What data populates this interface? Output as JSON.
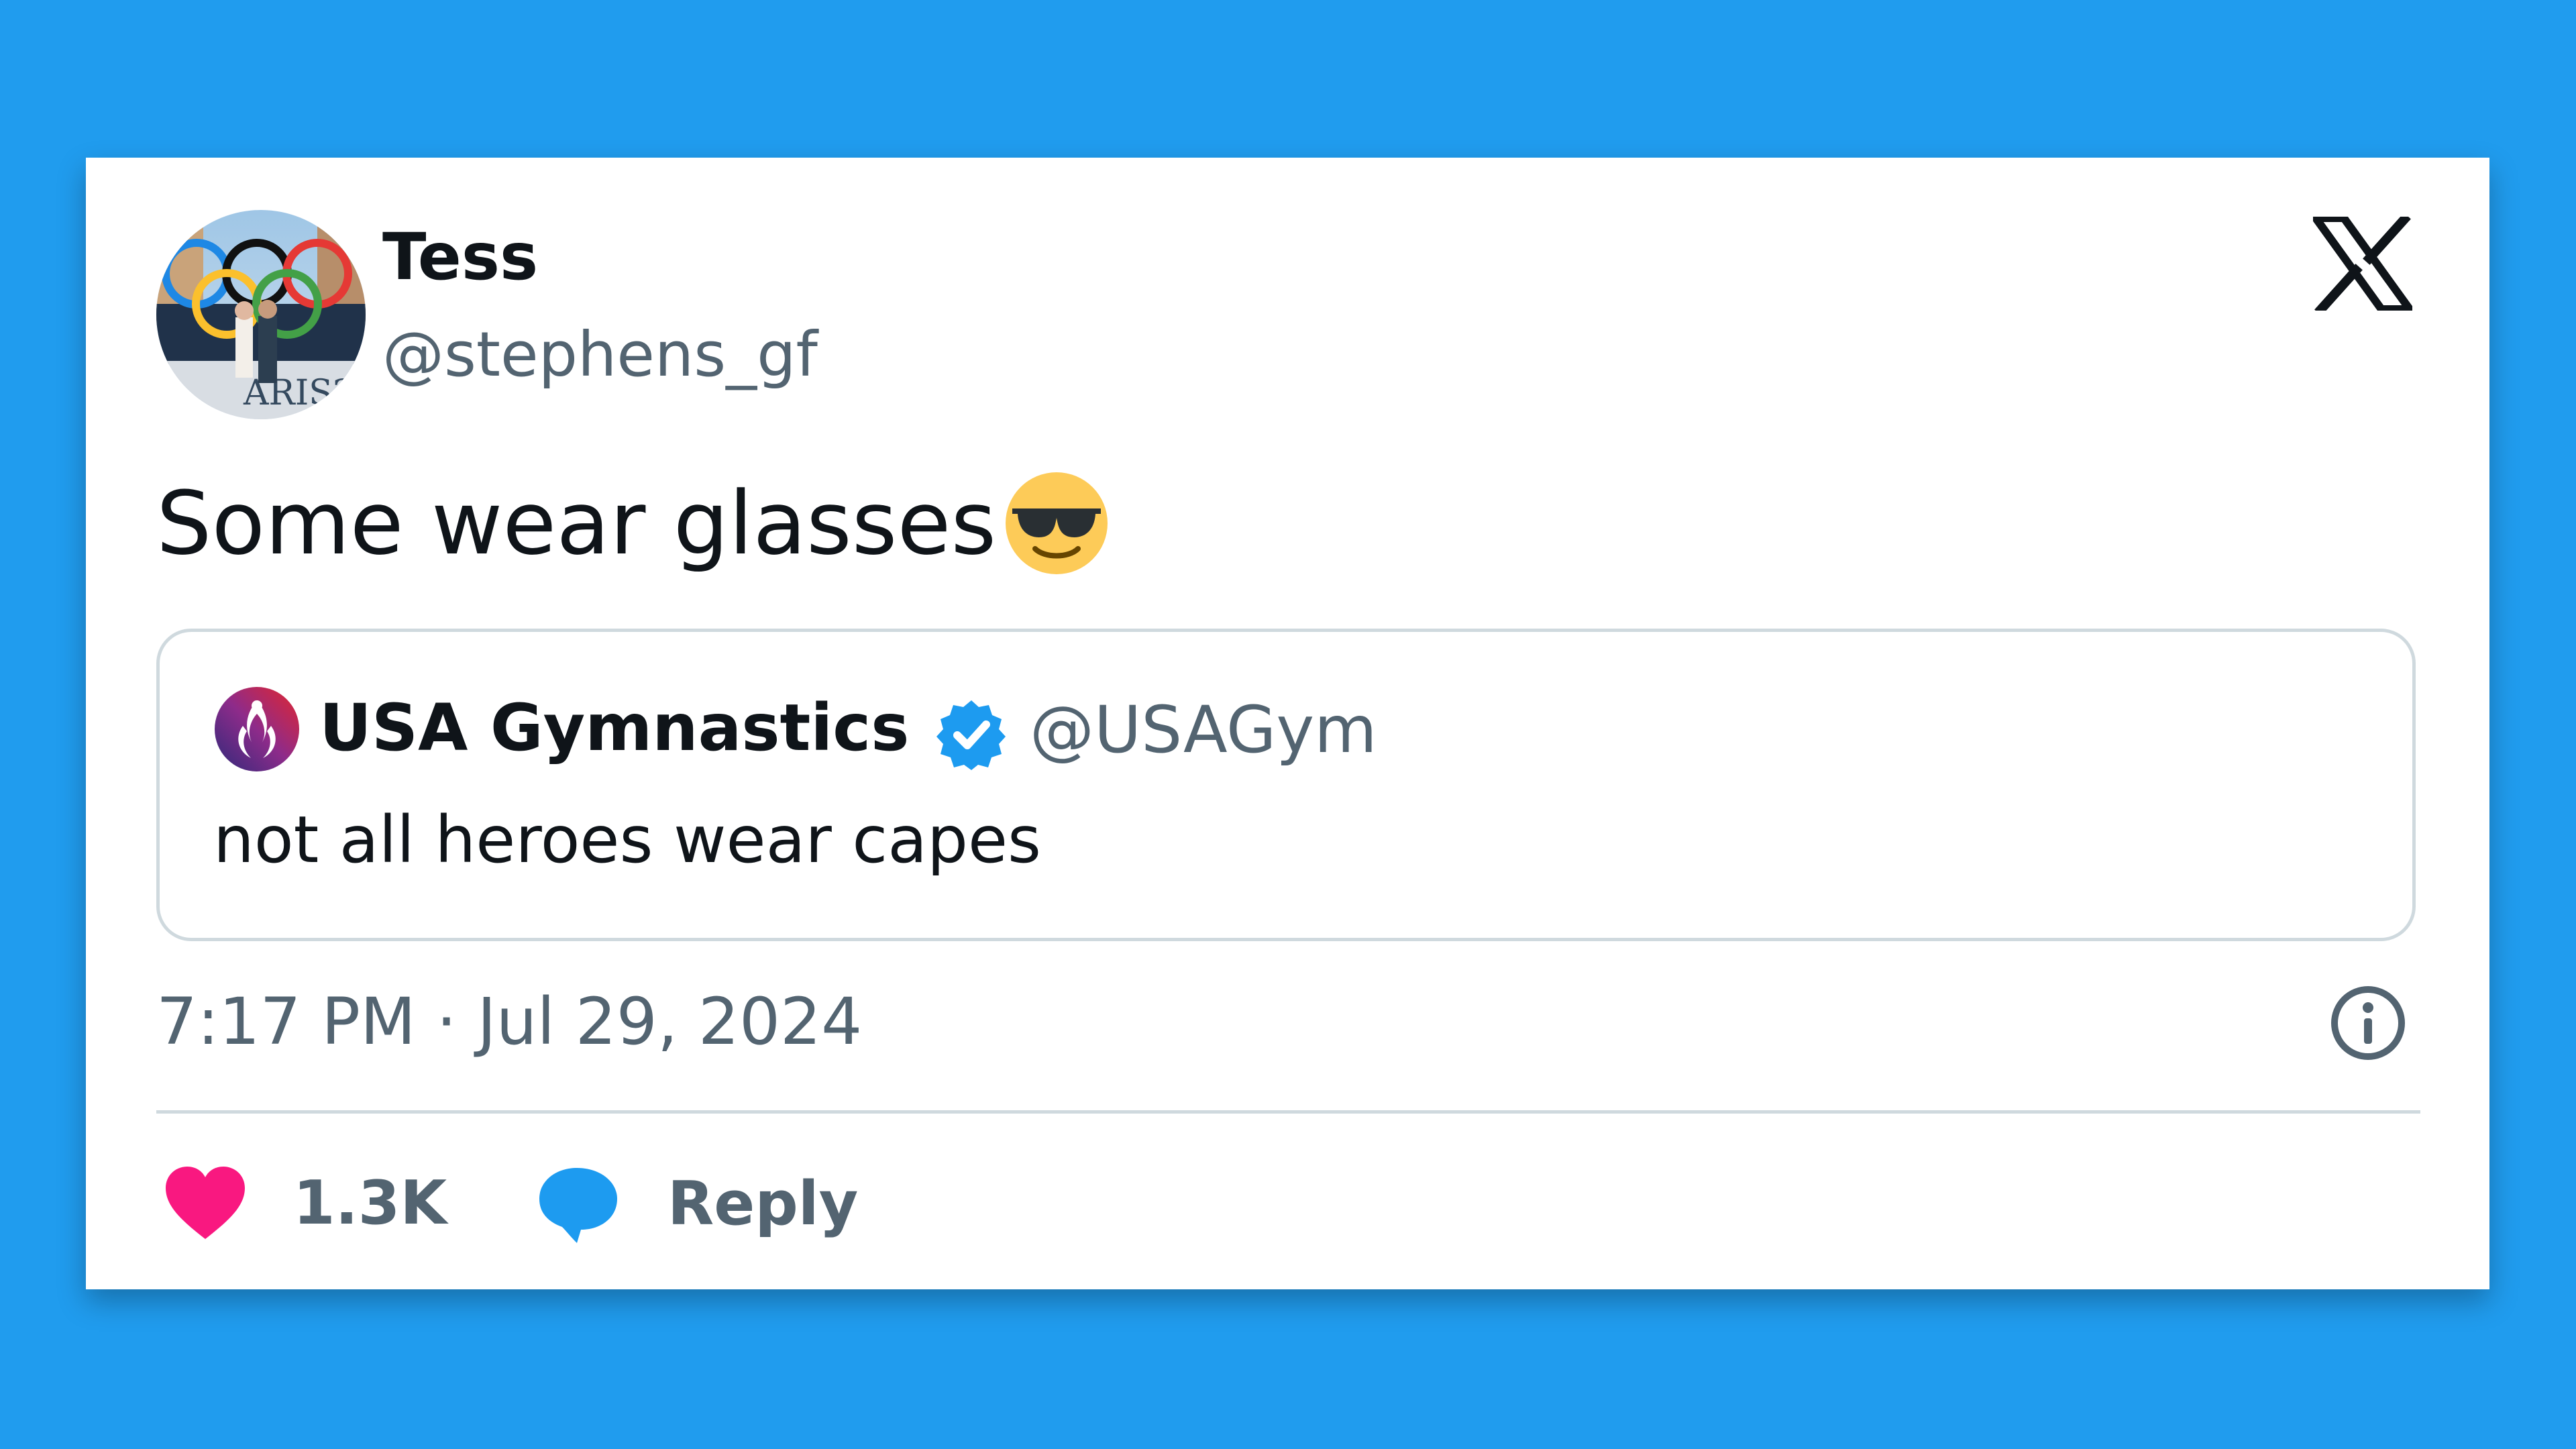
{
  "tweet": {
    "author": {
      "display_name": "Tess",
      "handle": "@stephens_gf",
      "avatar": "olympic-rings-photo"
    },
    "text": "Some wear glasses",
    "emoji": "smiling-face-with-sunglasses",
    "quoted": {
      "display_name": "USA Gymnastics",
      "handle": "@USAGym",
      "verified": true,
      "text": "not all heroes wear capes",
      "avatar": "usa-gymnastics-logo"
    },
    "timestamp": "7:17 PM · Jul 29, 2024",
    "actions": {
      "like_count": "1.3K",
      "reply_label": "Reply"
    }
  },
  "colors": {
    "background": "#209cee",
    "card": "#ffffff",
    "text_primary": "#0f1419",
    "text_secondary": "#536471",
    "border": "#cfd9de",
    "heart": "#f91880",
    "verified": "#1d9bf0",
    "reply": "#1d9bf0"
  },
  "icons": [
    "x-logo-icon",
    "verified-badge-icon",
    "info-icon",
    "heart-icon",
    "reply-bubble-icon"
  ]
}
